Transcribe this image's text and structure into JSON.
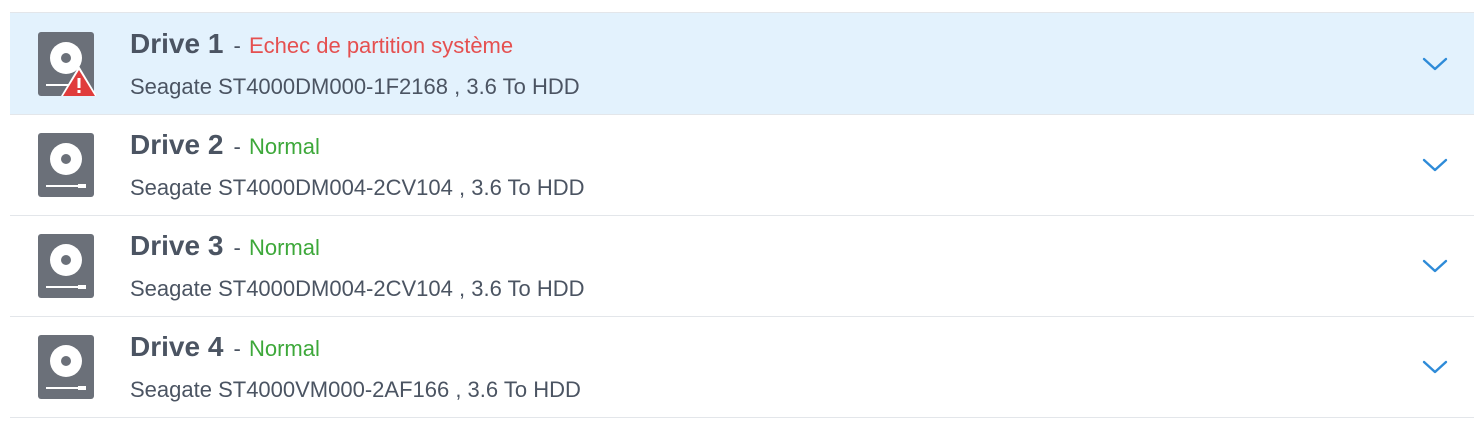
{
  "drives": [
    {
      "name": "Drive 1",
      "separator": "-",
      "status": "Echec de partition système",
      "status_kind": "error",
      "model": "Seagate ST4000DM000-1F2168 , 3.6 To HDD",
      "icon": "hdd-warning-icon"
    },
    {
      "name": "Drive 2",
      "separator": "-",
      "status": "Normal",
      "status_kind": "ok",
      "model": "Seagate ST4000DM004-2CV104 , 3.6 To HDD",
      "icon": "hdd-icon"
    },
    {
      "name": "Drive 3",
      "separator": "-",
      "status": "Normal",
      "status_kind": "ok",
      "model": "Seagate ST4000DM004-2CV104 , 3.6 To HDD",
      "icon": "hdd-icon"
    },
    {
      "name": "Drive 4",
      "separator": "-",
      "status": "Normal",
      "status_kind": "ok",
      "model": "Seagate ST4000VM000-2AF166 , 3.6 To HDD",
      "icon": "hdd-icon"
    }
  ],
  "colors": {
    "selected_row_bg": "#e3f2fd",
    "error": "#e55050",
    "ok": "#3da83a",
    "text": "#4b5462",
    "icon_gray": "#6b7079",
    "chevron": "#2e8bd8"
  }
}
